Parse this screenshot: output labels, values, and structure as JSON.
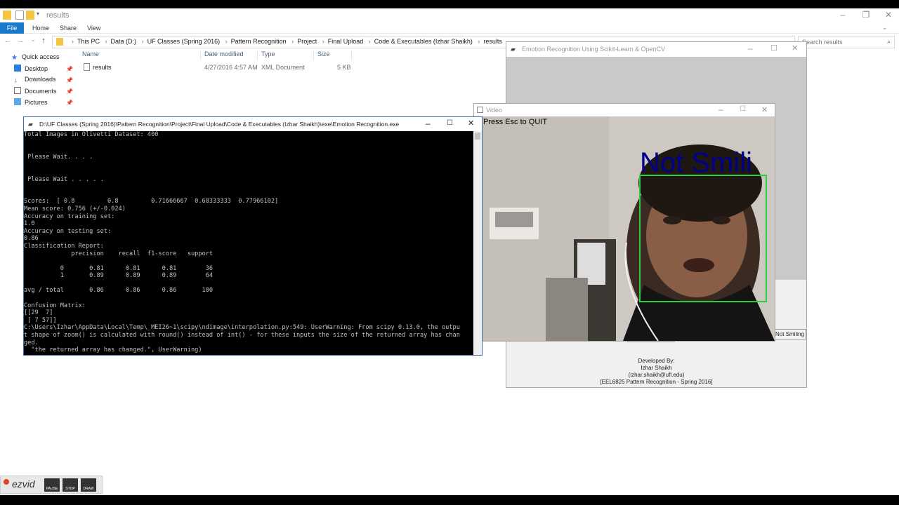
{
  "explorer": {
    "title": "results",
    "ribbon_tabs": [
      "File",
      "Home",
      "Share",
      "View"
    ],
    "breadcrumb": [
      "This PC",
      "Data (D:)",
      "UF Classes (Spring 2016)",
      "Pattern Recognition",
      "Project",
      "Final Upload",
      "Code & Executables (Izhar Shaikh)",
      "results"
    ],
    "search_placeholder": "Search results",
    "nav": {
      "quick_access": "Quick access",
      "items": [
        "Desktop",
        "Downloads",
        "Documents",
        "Pictures"
      ]
    },
    "columns": [
      "Name",
      "Date modified",
      "Type",
      "Size"
    ],
    "files": [
      {
        "name": "results",
        "date": "4/27/2016 4:57 AM",
        "type": "XML Document",
        "size": "5 KB"
      }
    ]
  },
  "emotion_app": {
    "title": "Emotion Recognition Using Scikit-Learn & OpenCV",
    "result_button": "Not Smiling",
    "credits": [
      "Developed By:",
      "Izhar Shaikh",
      "(izhar.shaikh@ufl.edu)",
      "[EEL6825 Pattern Recognition - Spring 2016]"
    ]
  },
  "video": {
    "title": "Video",
    "hint": "Press Esc to QUIT",
    "label": "Not Smili"
  },
  "console": {
    "title": "D:\\UF Classes (Spring 2016)\\Pattern Recognition\\Project\\Final Upload\\Code & Executables (Izhar Shaikh)\\exe\\Emotion Recognition.exe",
    "lines": [
      "Total Images in Olivetti Dataset: 400",
      "",
      "",
      " Please Wait. . . .",
      "",
      "",
      " Please Wait . . . . .",
      "",
      "",
      "Scores:  [ 0.8         0.8         0.71666667  0.68333333  0.77966102]",
      "Mean score: 0.756 (+/-0.024)",
      "Accuracy on training set:",
      "1.0",
      "Accuracy on testing set:",
      "0.86",
      "Classification Report:",
      "             precision    recall  f1-score   support",
      "",
      "          0       0.81      0.81      0.81        36",
      "          1       0.89      0.89      0.89        64",
      "",
      "avg / total       0.86      0.86      0.86       100",
      "",
      "Confusion Matrix:",
      "[[29  7]",
      " [ 7 57]]",
      "C:\\Users\\Izhar\\AppData\\Local\\Temp\\_MEI26~1\\scipy\\ndimage\\interpolation.py:549: UserWarning: From scipy 0.13.0, the outpu",
      "t shape of zoom() is calculated with round() instead of int() - for these inputs the size of the returned array has chan",
      "ged.",
      "  \"the returned array has changed.\", UserWarning)"
    ]
  },
  "recorder": {
    "logo": "ezvid",
    "buttons": [
      "PAUSE",
      "STOP",
      "DRAW"
    ]
  },
  "colors": {
    "file_tab": "#1979ca",
    "face_box": "#2ecc40",
    "label_text": "#00008b"
  }
}
